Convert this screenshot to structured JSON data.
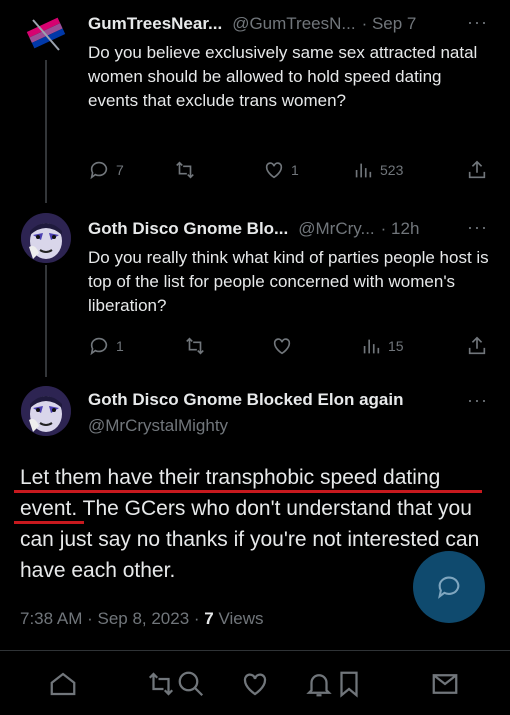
{
  "tweets": [
    {
      "name": "GumTreesNear...",
      "handle": "@GumTreesN...",
      "time": "· Sep 7",
      "text": "Do you believe exclusively same sex attracted natal women should be allowed to hold speed dating events that exclude trans women?",
      "replies": "7",
      "retweets": "",
      "likes": "1",
      "views": "523"
    },
    {
      "name": "Goth Disco Gnome Blo...",
      "handle": "@MrCry...",
      "time": "· 12h",
      "text": "Do you really think what kind of parties people host is top of the list for people concerned with women's liberation?",
      "replies": "1",
      "retweets": "",
      "likes": "",
      "views": "15"
    }
  ],
  "main": {
    "name": "Goth Disco Gnome Blocked Elon again",
    "handle": "@MrCrystalMighty",
    "text": "Let them have their transphobic speed dating event. The GCers who don't understand that you can just say no thanks if you're not interested can have each other.",
    "time": "7:38 AM · Sep 8, 2023 · ",
    "views_count": "7",
    "views_label": " Views"
  },
  "more_label": "···",
  "colors": {
    "background": "#000000",
    "text": "#e7e9ea",
    "muted": "#71767b",
    "underline": "#c7191e",
    "fab": "#0f4a6e"
  },
  "icons": [
    "reply-icon",
    "retweet-icon",
    "like-icon",
    "views-icon",
    "share-icon",
    "compose-reply-icon",
    "home-icon",
    "search-icon",
    "heart-icon",
    "notifications-icon",
    "bookmark-icon",
    "messages-icon"
  ]
}
